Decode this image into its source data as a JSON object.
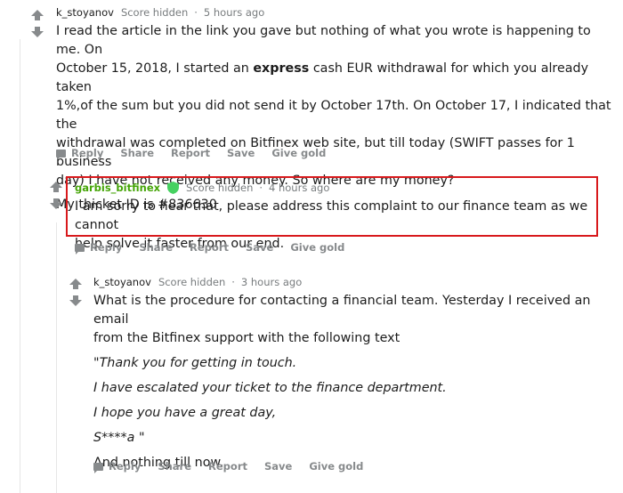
{
  "comments": [
    {
      "username": "k_stoyanov",
      "score": "Score hidden",
      "separator": "·",
      "time": "5 hours ago",
      "body": {
        "line1": "I read the article in the link you gave but nothing of what you wrote is happening to me. On",
        "line2_pre": "October 15, 2018, I started an ",
        "line2_bold": "express",
        "line2_post": " cash EUR withdrawal for which you already taken",
        "line3": "1%,of the sum but you did not send it by October 17th. On October 17, I indicated that the",
        "line4": "withdrawal was completed on Bitfinex web site, but till today (SWIFT passes for 1 business",
        "line5": "day) I have not received any money. So where are my money?",
        "line6": "My thicket ID is #836630"
      },
      "actions": {
        "reply": "Reply",
        "share": "Share",
        "report": "Report",
        "save": "Save",
        "give_gold": "Give gold"
      }
    },
    {
      "username": "garbis_bitfinex",
      "score": "Score hidden",
      "separator": "·",
      "time": "4 hours ago",
      "body": {
        "line1": "I am sorry to hear that, please address this complaint to our finance team as we cannot",
        "line2": "help solve it faster from our end."
      },
      "actions": {
        "reply": "Reply",
        "share": "Share",
        "report": "Report",
        "save": "Save",
        "give_gold": "Give gold"
      }
    },
    {
      "username": "k_stoyanov",
      "score": "Score hidden",
      "separator": "·",
      "time": "3 hours ago",
      "body": {
        "line1": "What is the procedure for contacting a financial team. Yesterday I received an email",
        "line2": "from the Bitfinex support with the following text",
        "quote1": "\"Thank you for getting in touch.",
        "quote2": "I have escalated your ticket to the finance department.",
        "quote3": "I hope you have a great day,",
        "quote4": "S****a \"",
        "line3": "And nothing till now."
      },
      "actions": {
        "reply": "Reply",
        "share": "Share",
        "report": "Report",
        "save": "Save",
        "give_gold": "Give gold"
      }
    }
  ],
  "colors": {
    "highlight_border": "#d8191c",
    "moderator_green": "#46a508",
    "meta_gray": "#787c7e"
  },
  "icons": [
    "upvote-icon",
    "downvote-icon",
    "shield-icon",
    "comment-bubble-icon"
  ]
}
